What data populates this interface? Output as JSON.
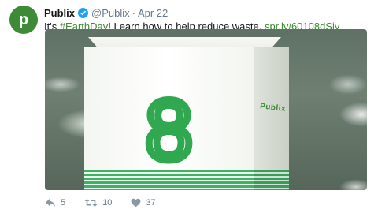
{
  "tweet": {
    "avatar_letter": "p",
    "name": "Publix",
    "handle": "@Publix",
    "separator": "·",
    "date": "Apr 22",
    "text_before": "It's ",
    "hashtag": "#EarthDay",
    "text_after": "! Learn how to help reduce waste. ",
    "link": "spr.ly/60108dSjy"
  },
  "media": {
    "sign_number": "8",
    "side_logo": "Publix"
  },
  "actions": {
    "replies": "5",
    "retweets": "10",
    "likes": "37"
  },
  "colors": {
    "brand_green": "#3d8b37",
    "verified_blue": "#1da1f2",
    "muted": "#657786"
  }
}
